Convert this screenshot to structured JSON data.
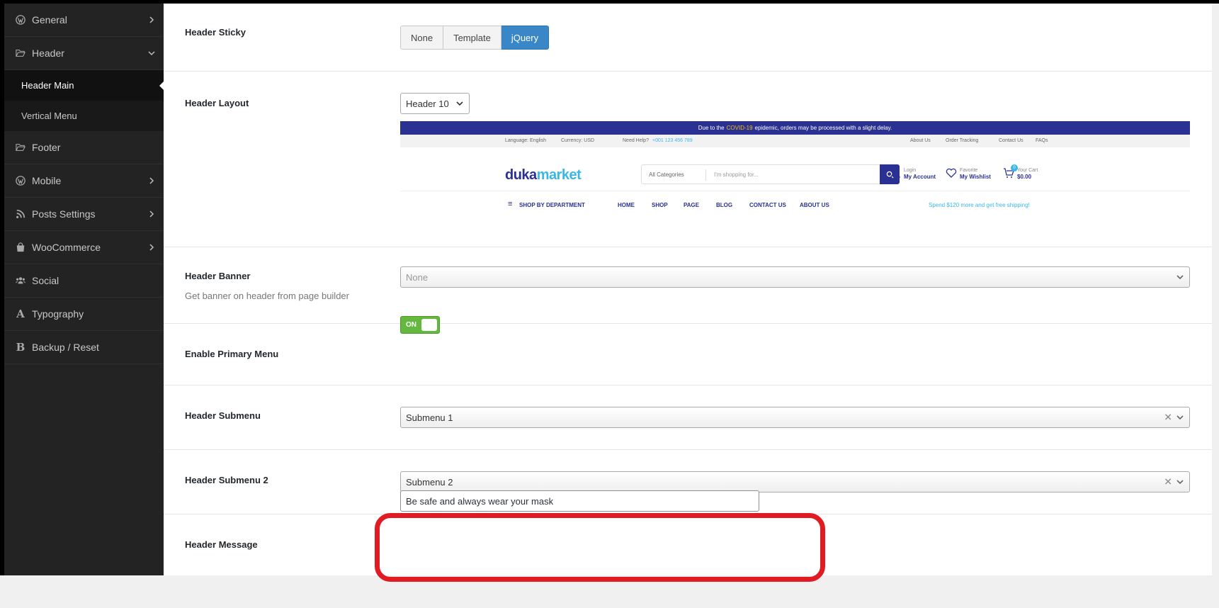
{
  "sidebar": {
    "items": [
      {
        "label": "General",
        "icon": "wordpress-icon",
        "chevron": "right"
      },
      {
        "label": "Header",
        "icon": "folder-open-icon",
        "chevron": "down"
      },
      {
        "label": "Footer",
        "icon": "folder-open-icon",
        "chevron": ""
      },
      {
        "label": "Mobile",
        "icon": "wordpress-icon",
        "chevron": "right"
      },
      {
        "label": "Posts Settings",
        "icon": "rss-icon",
        "chevron": "right"
      },
      {
        "label": "WooCommerce",
        "icon": "shopping-bag-icon",
        "chevron": "right"
      },
      {
        "label": "Social",
        "icon": "users-icon",
        "chevron": ""
      },
      {
        "label": "Typography",
        "icon": "font-icon",
        "chevron": ""
      },
      {
        "label": "Backup / Reset",
        "icon": "bold-icon",
        "chevron": ""
      }
    ],
    "header_sub": [
      {
        "label": "Header Main",
        "active": true
      },
      {
        "label": "Vertical Menu",
        "active": false
      }
    ]
  },
  "settings": {
    "sticky": {
      "label": "Header Sticky",
      "options": [
        "None",
        "Template",
        "jQuery"
      ],
      "selected": "jQuery"
    },
    "layout": {
      "label": "Header Layout",
      "value": "Header 10"
    },
    "banner": {
      "label": "Header Banner",
      "description": "Get banner on header from page builder",
      "value": "None"
    },
    "primary_menu": {
      "label": "Enable Primary Menu",
      "toggle_text": "ON",
      "on": true
    },
    "submenu": {
      "label": "Header Submenu",
      "value": "Submenu 1"
    },
    "submenu2": {
      "label": "Header Submenu 2",
      "value": "Submenu 2"
    },
    "message": {
      "label": "Header Message",
      "value": "Be safe and always wear your mask"
    }
  },
  "preview": {
    "announcement_pre": "Due to the",
    "announcement_hl": "COVID-19",
    "announcement_post": "epidemic, orders may be processed with a slight delay.",
    "language": "Language: English",
    "currency": "Currency: USD",
    "help_label": "Need Help?",
    "help_phone": "+001 123 456 789",
    "top_links": [
      "About Us",
      "Order Tracking",
      "Contact Us",
      "FAQs"
    ],
    "logo_a": "duka",
    "logo_b": "market",
    "search_category": "All Categories",
    "search_placeholder": "I'm shopping for...",
    "account_small": "Login",
    "account_big": "My Account",
    "wishlist_small": "Favorite",
    "wishlist_big": "My Wishlist",
    "cart_small": "Your Cart",
    "cart_big": "$0.00",
    "cart_count": "0",
    "department": "SHOP BY DEPARTMENT",
    "nav": [
      "HOME",
      "SHOP",
      "PAGE",
      "BLOG",
      "CONTACT US",
      "ABOUT US"
    ],
    "promo": "Spend $120 more and get free shipping!"
  },
  "colors": {
    "sidebar_bg": "#232323",
    "accent_blue": "#3a87c8",
    "toggle_green": "#64b83e",
    "annotation_red": "#e11b22",
    "brand_navy": "#2b3193",
    "brand_cyan": "#3bb7e6"
  }
}
